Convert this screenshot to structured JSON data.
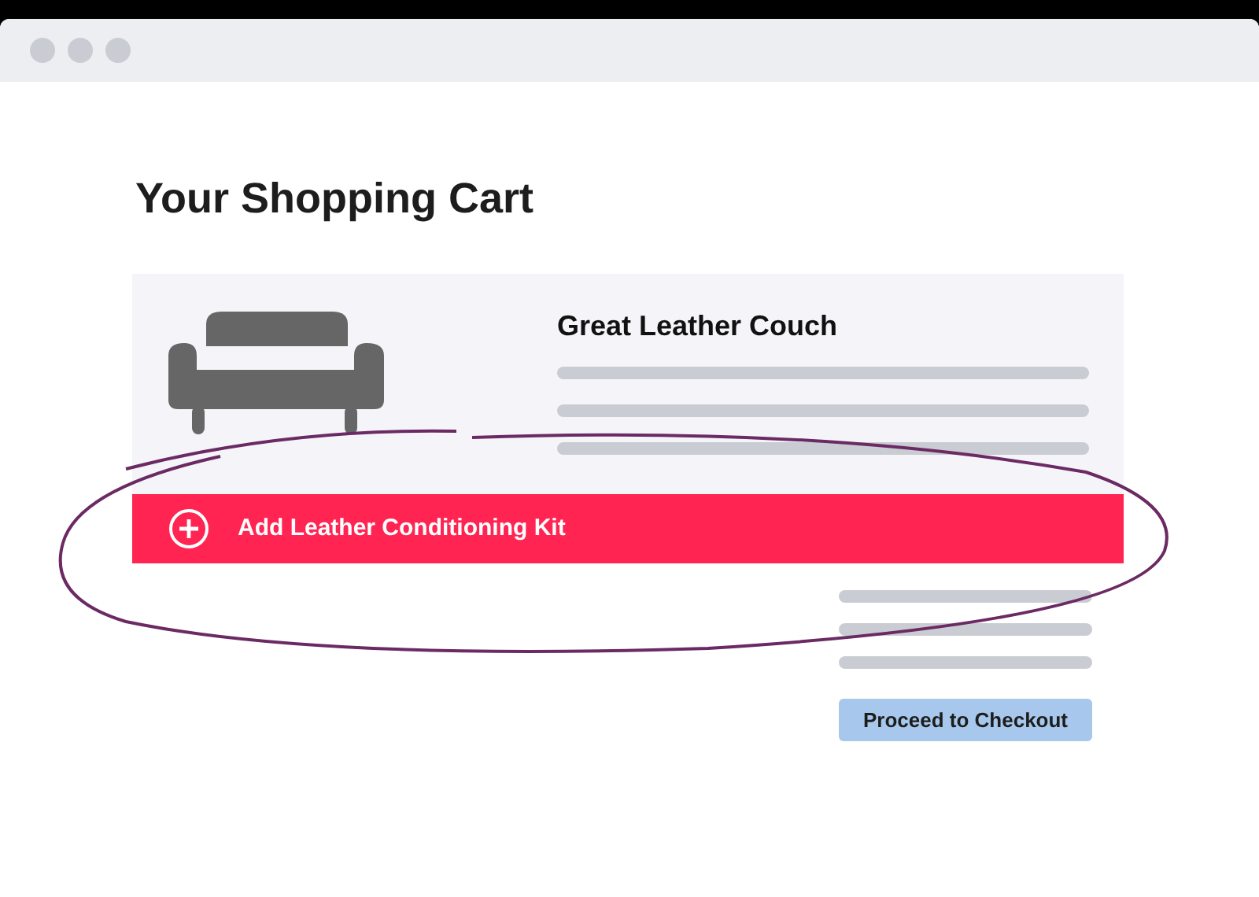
{
  "page": {
    "title": "Your Shopping Cart"
  },
  "cart_item": {
    "name": "Great Leather Couch"
  },
  "add_on": {
    "label": "Add Leather Conditioning Kit"
  },
  "checkout_button": {
    "label": "Proceed to Checkout"
  }
}
